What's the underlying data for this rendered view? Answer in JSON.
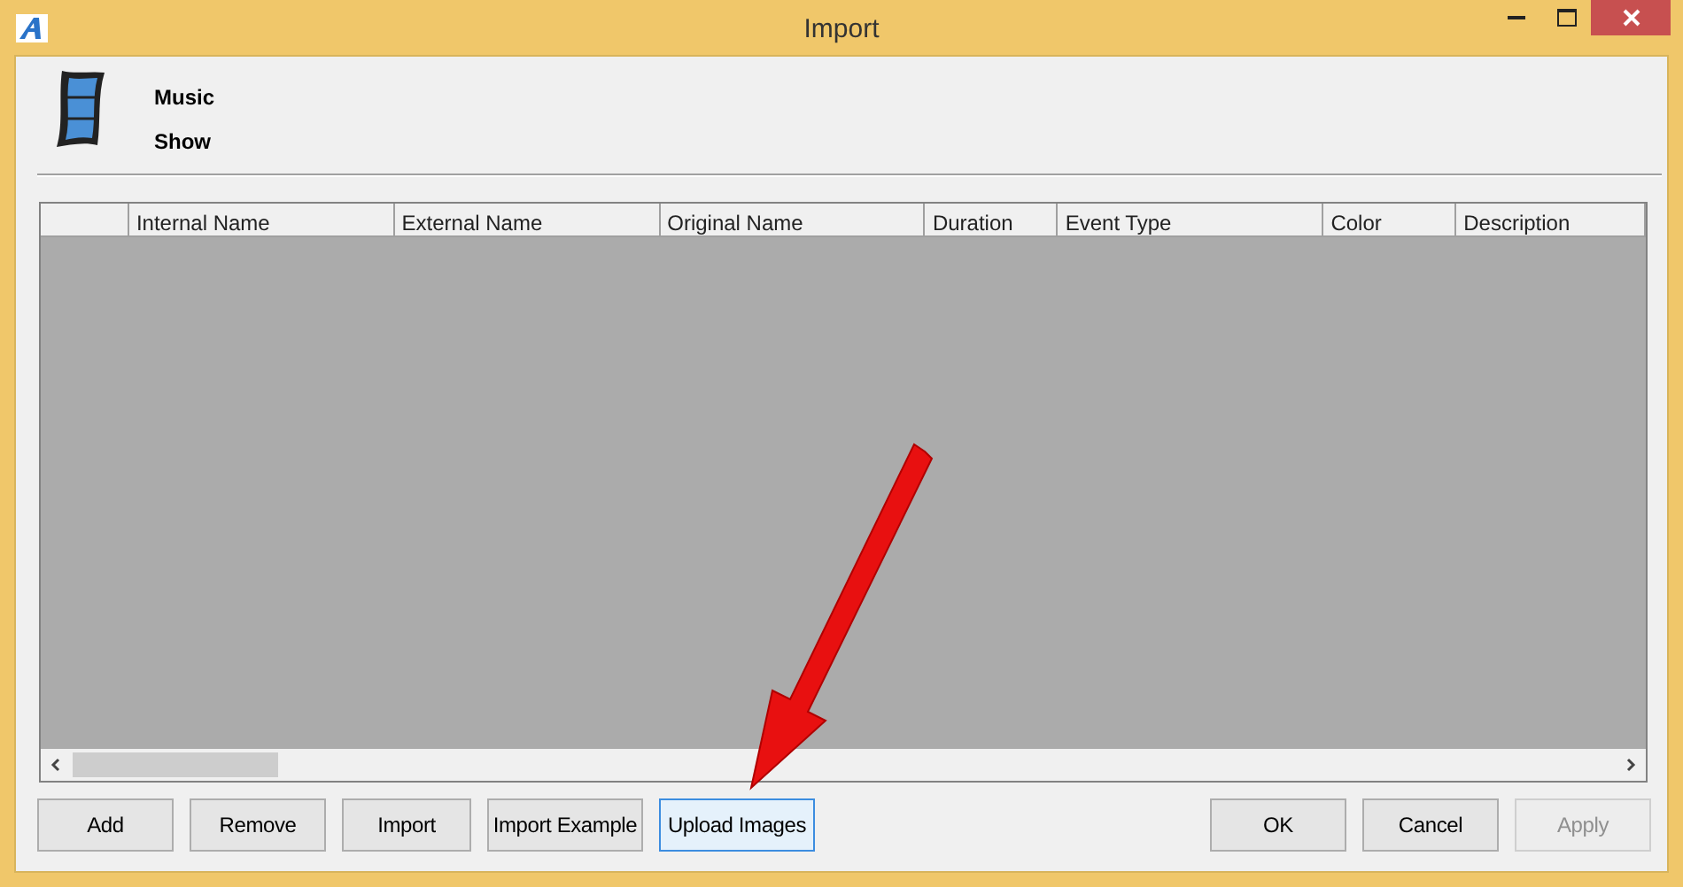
{
  "window": {
    "title": "Import"
  },
  "header": {
    "lines": [
      "Music",
      "Show"
    ]
  },
  "table": {
    "columns": [
      "",
      "Internal Name",
      "External Name",
      "Original Name",
      "Duration",
      "Event Type",
      "Color",
      "Description"
    ]
  },
  "buttons_left": [
    {
      "label": "Add",
      "focused": false,
      "disabled": false
    },
    {
      "label": "Remove",
      "focused": false,
      "disabled": false
    },
    {
      "label": "Import",
      "focused": false,
      "disabled": false
    },
    {
      "label": "Import Example",
      "focused": false,
      "disabled": false
    },
    {
      "label": "Upload Images",
      "focused": true,
      "disabled": false
    }
  ],
  "buttons_right": [
    {
      "label": "OK",
      "focused": false,
      "disabled": false
    },
    {
      "label": "Cancel",
      "focused": false,
      "disabled": false
    },
    {
      "label": "Apply",
      "focused": false,
      "disabled": true
    }
  ]
}
